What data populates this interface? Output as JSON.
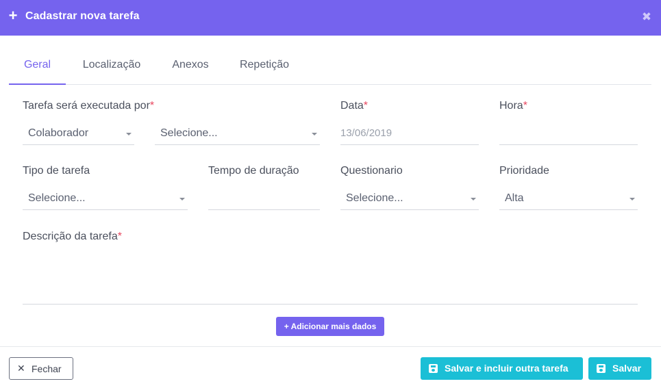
{
  "header": {
    "title": "Cadastrar nova tarefa"
  },
  "tabs": [
    {
      "label": "Geral",
      "active": true
    },
    {
      "label": "Localização",
      "active": false
    },
    {
      "label": "Anexos",
      "active": false
    },
    {
      "label": "Repetição",
      "active": false
    }
  ],
  "form": {
    "executed_by": {
      "label": "Tarefa será executada por",
      "required": "*",
      "type_value": "Colaborador",
      "person_placeholder": "Selecione..."
    },
    "date": {
      "label": "Data",
      "required": "*",
      "value": "13/06/2019"
    },
    "time": {
      "label": "Hora",
      "required": "*",
      "value": ""
    },
    "task_type": {
      "label": "Tipo de tarefa",
      "value": "Selecione..."
    },
    "duration": {
      "label": "Tempo de duração",
      "value": ""
    },
    "questionnaire": {
      "label": "Questionario",
      "value": "Selecione..."
    },
    "priority": {
      "label": "Prioridade",
      "value": "Alta"
    },
    "description": {
      "label": "Descrição da tarefa",
      "required": "*",
      "value": ""
    }
  },
  "add_more_label": "+ Adicionar mais dados",
  "footer": {
    "close_label": "Fechar",
    "save_and_new_label": "Salvar e incluir outra tarefa",
    "save_label": "Salvar"
  },
  "colors": {
    "accent": "#7563ee",
    "save": "#1bbfd6",
    "required": "#e8475f"
  }
}
